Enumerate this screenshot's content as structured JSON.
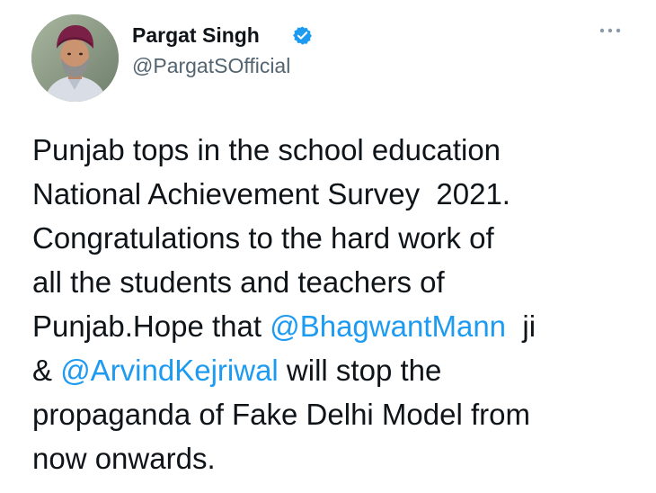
{
  "author": {
    "name": "Pargat Singh",
    "handle": "@PargatSOfficial",
    "avatar_icon": "profile-photo-avatar",
    "verified_icon": "verified-badge-icon"
  },
  "menu": {
    "icon": "more-options-icon"
  },
  "tweet": {
    "line1": "Punjab tops in the school education",
    "line2": "National Achievement Survey  2021.",
    "line3": "Congratulations to the hard work of",
    "line4": "all the students and teachers of",
    "line5_pre": "Punjab.Hope that ",
    "mention1": "@BhagwantMann",
    "line5_post": "  ji",
    "line6_pre": "& ",
    "mention2": "@ArvindKejriwal",
    "line6_post": " will stop the",
    "line7": "propaganda of Fake Delhi Model from",
    "line8": "now onwards."
  },
  "colors": {
    "text": "#0f1419",
    "secondary": "#536471",
    "link": "#1d9bf0",
    "verified": "#1d9bf0"
  }
}
